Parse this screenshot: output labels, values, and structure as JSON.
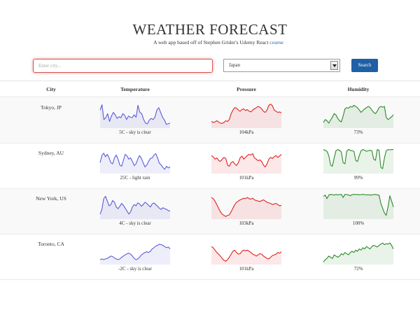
{
  "header": {
    "title": "WEATHER FORECAST",
    "subtitle_prefix": "A web app based off of Stephen Grider's Udemy React",
    "subtitle_link": "course"
  },
  "search": {
    "placeholder": "Enter city...",
    "value": "",
    "country_value": "Japan",
    "button_label": "Search"
  },
  "table": {
    "headers": [
      "City",
      "Temperature",
      "Pressure",
      "Humidity"
    ]
  },
  "colors": {
    "temperature": "#5b5bdb",
    "pressure": "#e0221e",
    "humidity": "#2a8a26",
    "accent": "#1f5fa6",
    "input_error_border": "#d9534f"
  },
  "rows": [
    {
      "city": "Tokyo, JP",
      "temperature_caption": "5C - sky is clear",
      "pressure_caption": "104kPa",
      "humidity_caption": "73%",
      "temperature_series": [
        70,
        92,
        30,
        38,
        55,
        22,
        45,
        60,
        50,
        35,
        42,
        38,
        55,
        48,
        30,
        45,
        40,
        38,
        50,
        40,
        90,
        60,
        55,
        30,
        15,
        12,
        28,
        35,
        30,
        40,
        70,
        80,
        60,
        40,
        28,
        10,
        12,
        15
      ],
      "pressure_series": [
        22,
        18,
        20,
        25,
        20,
        15,
        14,
        18,
        25,
        22,
        30,
        55,
        70,
        80,
        78,
        70,
        65,
        72,
        75,
        68,
        72,
        65,
        62,
        70,
        75,
        80,
        85,
        82,
        75,
        65,
        60,
        70,
        90,
        95,
        88,
        70,
        65,
        60,
        62,
        58
      ],
      "humidity_series": [
        18,
        30,
        25,
        15,
        28,
        40,
        55,
        50,
        35,
        25,
        20,
        45,
        75,
        80,
        78,
        85,
        82,
        90,
        85,
        80,
        70,
        60,
        68,
        75,
        80,
        85,
        80,
        70,
        60,
        55,
        65,
        80,
        85,
        82,
        85,
        40,
        30,
        35,
        42,
        50
      ]
    },
    {
      "city": "Sydney, AU",
      "temperature_caption": "25C - light rain",
      "pressure_caption": "101kPa",
      "humidity_caption": "99%",
      "temperature_series": [
        40,
        70,
        80,
        65,
        75,
        60,
        40,
        35,
        60,
        72,
        55,
        30,
        25,
        50,
        75,
        68,
        55,
        60,
        45,
        28,
        35,
        55,
        70,
        58,
        40,
        22,
        30,
        45,
        58,
        60,
        72,
        78,
        60,
        38,
        30,
        20,
        12,
        25,
        18,
        22
      ],
      "pressure_series": [
        70,
        65,
        55,
        60,
        50,
        45,
        55,
        62,
        58,
        30,
        25,
        40,
        45,
        35,
        28,
        40,
        60,
        68,
        55,
        62,
        70,
        75,
        72,
        78,
        60,
        55,
        48,
        52,
        45,
        30,
        22,
        35,
        55,
        62,
        58,
        65,
        70,
        62,
        68,
        75
      ],
      "humidity_series": [
        95,
        92,
        88,
        70,
        30,
        25,
        60,
        90,
        95,
        92,
        85,
        40,
        35,
        88,
        95,
        92,
        90,
        88,
        50,
        45,
        70,
        90,
        95,
        92,
        88,
        90,
        92,
        90,
        55,
        50,
        95,
        92,
        20,
        15,
        60,
        90,
        95,
        94,
        95,
        96
      ]
    },
    {
      "city": "New York, US",
      "temperature_caption": "4C - sky is clear",
      "pressure_caption": "103kPa",
      "humidity_caption": "100%",
      "temperature_series": [
        15,
        35,
        80,
        90,
        70,
        50,
        55,
        72,
        65,
        45,
        38,
        48,
        60,
        52,
        40,
        28,
        15,
        25,
        45,
        55,
        50,
        62,
        58,
        48,
        55,
        65,
        60,
        52,
        45,
        58,
        62,
        55,
        48,
        40,
        35,
        42,
        38,
        35,
        30,
        28
      ],
      "pressure_series": [
        85,
        80,
        70,
        55,
        40,
        25,
        15,
        10,
        5,
        10,
        12,
        25,
        40,
        55,
        65,
        70,
        75,
        78,
        82,
        80,
        85,
        80,
        78,
        82,
        75,
        72,
        70,
        68,
        72,
        75,
        70,
        65,
        62,
        60,
        55,
        58,
        60,
        55,
        50,
        52
      ],
      "humidity_series": [
        90,
        95,
        80,
        95,
        98,
        97,
        95,
        98,
        96,
        97,
        98,
        85,
        98,
        97,
        96,
        92,
        97,
        98,
        97,
        98,
        96,
        97,
        98,
        97,
        96,
        97,
        95,
        96,
        97,
        98,
        96,
        95,
        60,
        40,
        20,
        10,
        45,
        92,
        70,
        45
      ]
    },
    {
      "city": "Toronto, CA",
      "temperature_caption": "-2C - sky is clear",
      "pressure_caption": "101kPa",
      "humidity_caption": "72%",
      "temperature_series": [
        15,
        18,
        15,
        18,
        20,
        25,
        30,
        28,
        22,
        18,
        15,
        18,
        25,
        30,
        35,
        40,
        42,
        38,
        30,
        20,
        15,
        18,
        25,
        35,
        40,
        45,
        48,
        45,
        50,
        60,
        65,
        72,
        75,
        80,
        78,
        75,
        70,
        65,
        68,
        60
      ],
      "pressure_series": [
        70,
        65,
        55,
        45,
        38,
        30,
        20,
        12,
        8,
        15,
        25,
        38,
        50,
        55,
        45,
        38,
        40,
        50,
        55,
        52,
        55,
        50,
        45,
        38,
        35,
        30,
        35,
        40,
        38,
        30,
        25,
        20,
        18,
        25,
        32,
        35,
        38,
        45,
        42,
        48
      ],
      "humidity_series": [
        5,
        15,
        20,
        30,
        25,
        20,
        35,
        30,
        25,
        30,
        40,
        35,
        45,
        40,
        35,
        45,
        50,
        45,
        55,
        50,
        60,
        55,
        65,
        60,
        70,
        65,
        60,
        70,
        75,
        72,
        68,
        75,
        80,
        85,
        78,
        82,
        80,
        85,
        75,
        60
      ]
    }
  ]
}
